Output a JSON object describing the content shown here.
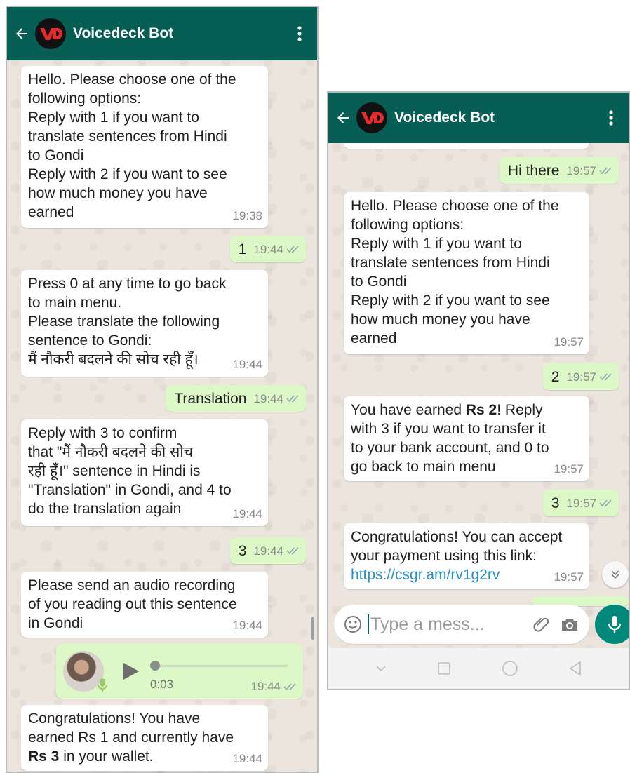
{
  "left": {
    "header": {
      "title": "Voicedeck Bot"
    },
    "messages": [
      {
        "text": "Hello. Please choose one of the\nfollowing options:\nReply with 1 if you want to\ntranslate sentences from Hindi\nto Gondi\nReply with 2 if you want to see\nhow much money you have\nearned",
        "time": "19:38"
      },
      {
        "text": "1",
        "time": "19:44"
      },
      {
        "text": "Press 0 at any time to go back\nto main menu.\nPlease translate the following\nsentence to Gondi:\nमैं नौकरी बदलने की सोच रही हूँ।",
        "time": "19:44"
      },
      {
        "text": "Translation",
        "time": "19:44"
      },
      {
        "text": "Reply with 3 to confirm\nthat \"मैं नौकरी बदलने की सोच\nरही हूँ।\" sentence in Hindi is\n\"Translation\" in Gondi, and 4 to\ndo the translation again",
        "time": "19:44"
      },
      {
        "text": "3",
        "time": "19:44"
      },
      {
        "text": "Please send an audio recording\nof you reading out this sentence\nin Gondi",
        "time": "19:44"
      },
      {
        "duration": "0:03",
        "time": "19:44"
      },
      {
        "text_before": "Congratulations! You have\nearned Rs 1 and currently have\n",
        "bold": "Rs 3",
        "text_after": " in your wallet.",
        "time": "19:44"
      }
    ]
  },
  "right": {
    "header": {
      "title": "Voicedeck Bot"
    },
    "messages": [
      {
        "text": "Hi there",
        "time": "19:57"
      },
      {
        "text": "Hello. Please choose one of the\nfollowing options:\nReply with 1 if you want to\ntranslate sentences from Hindi\nto Gondi\nReply with 2 if you want to see\nhow much money you have\nearned",
        "time": "19:57"
      },
      {
        "text": "2",
        "time": "19:57"
      },
      {
        "text_before": "You have earned ",
        "bold": "Rs 2",
        "text_after": "! Reply\nwith 3 if you want to transfer it\nto your bank account, and 0 to\ngo back to main menu",
        "time": "19:57"
      },
      {
        "text": "3",
        "time": "19:57"
      },
      {
        "text": "Congratulations! You can accept\nyour payment using this link:",
        "link": "https://csgr.am/rv1g2rv",
        "time": "19:57"
      }
    ],
    "input": {
      "placeholder": "Type a mess..."
    }
  },
  "colors": {
    "header": "#075e54",
    "incoming": "#ffffff",
    "outgoing": "#dcf8c6",
    "chat_background": "#ece5dd",
    "read_ticks": "#8fa6b3",
    "mic_button": "#00897b"
  },
  "icons": [
    "back-arrow-icon",
    "voicedeck-logo-icon",
    "more-vert-icon",
    "double-check-icon",
    "play-icon",
    "mic-icon",
    "chevron-down-icon",
    "emoji-icon",
    "attach-icon",
    "camera-icon",
    "nav-back-icon",
    "nav-home-icon",
    "nav-recents-icon",
    "nav-collapse-icon"
  ]
}
